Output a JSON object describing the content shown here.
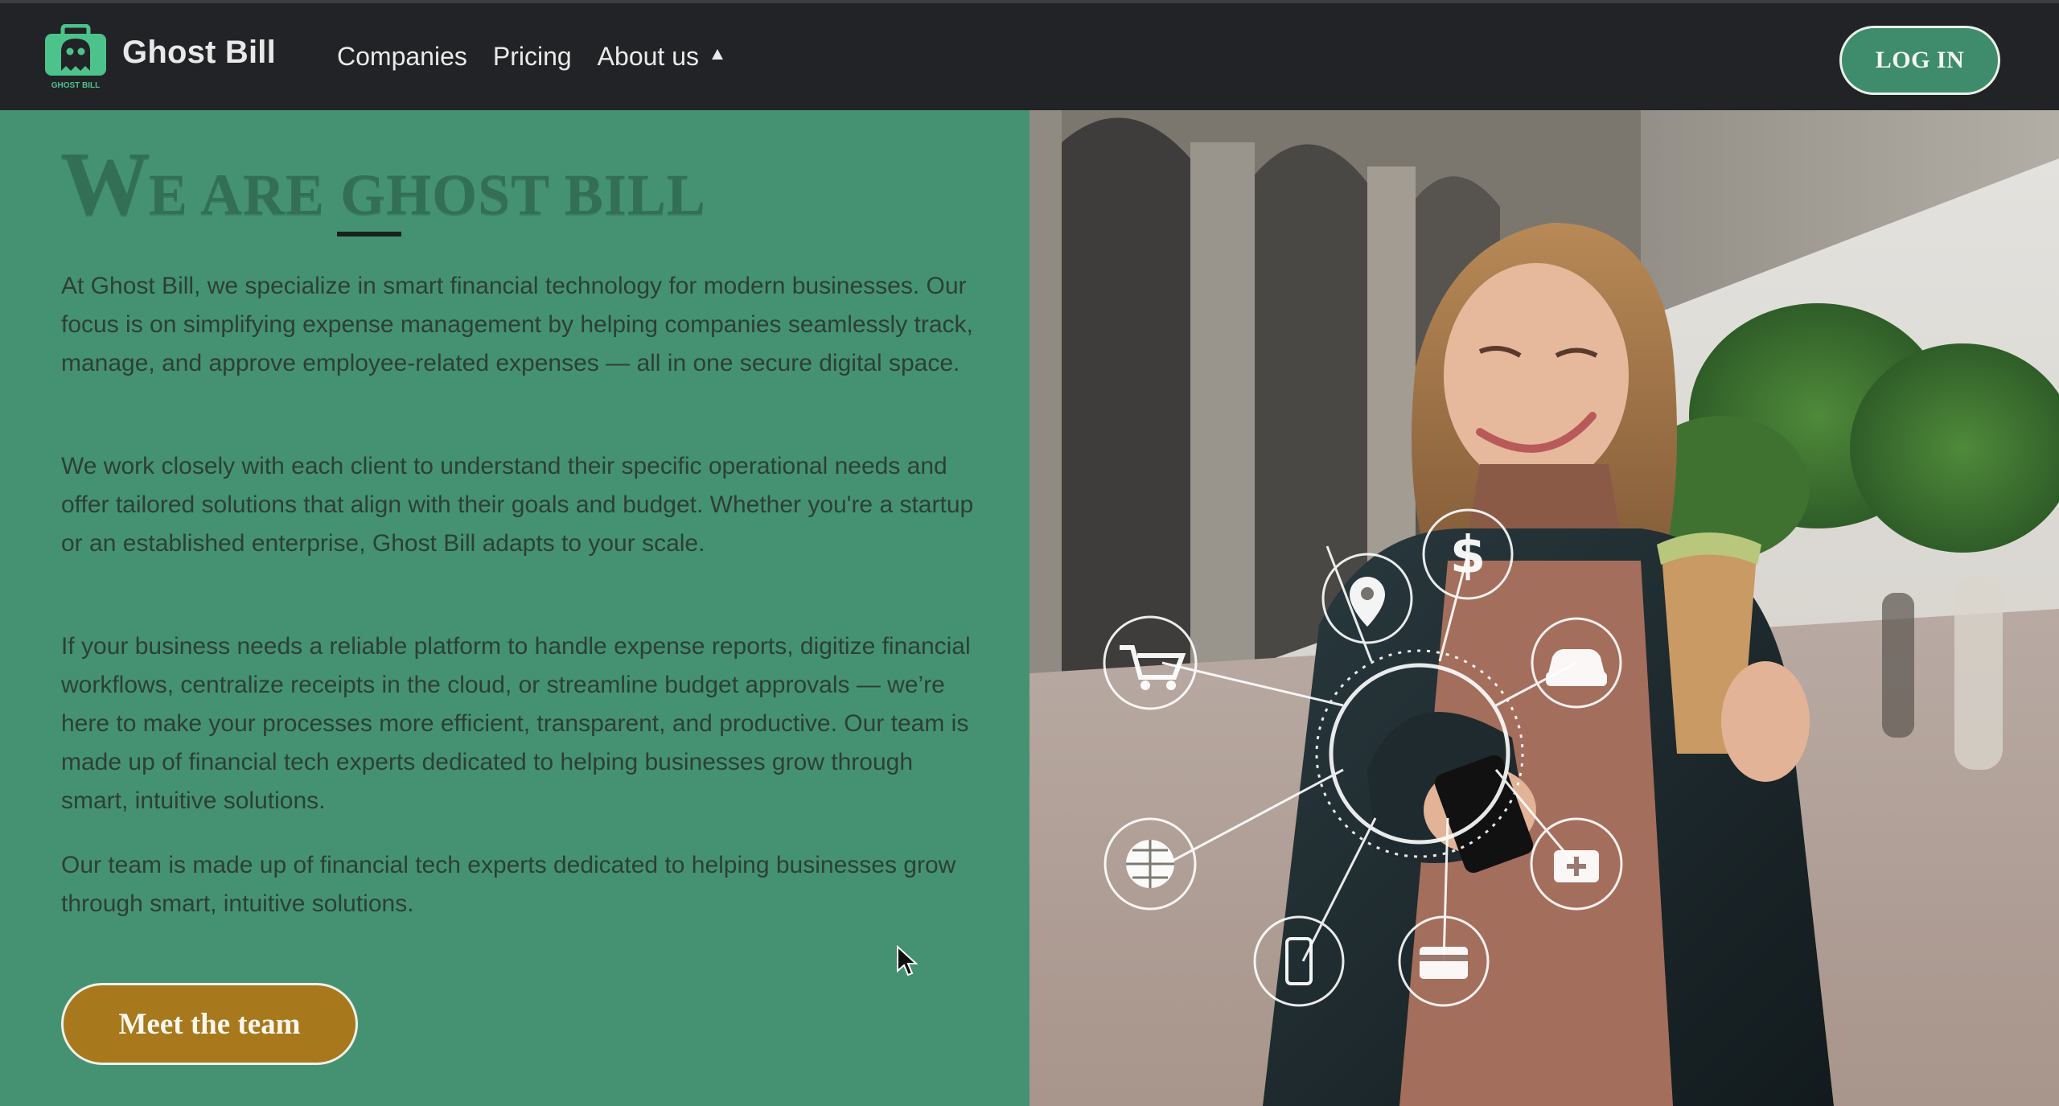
{
  "navbar": {
    "brand": {
      "logo_text": "GHOST BILL",
      "name": "Ghost Bill",
      "logo_icon": "ghost-briefcase-logo"
    },
    "links": [
      {
        "label": "Companies"
      },
      {
        "label": "Pricing"
      },
      {
        "label": "About us",
        "icon": "caret-up-icon"
      }
    ],
    "login_label": "LOG IN"
  },
  "hero": {
    "heading_first": "W",
    "heading_rest": "e are ghost bill",
    "paragraphs": [
      "At Ghost Bill, we specialize in smart financial technology for modern businesses. Our focus is on simplifying expense management by helping companies seamlessly track, manage, and approve employee-related expenses — all in one secure digital space.",
      "We work closely with each client to understand their specific operational needs and offer tailored solutions that align with their goals and budget. Whether you're a startup or an established enterprise, Ghost Bill adapts to your scale.",
      "If your business needs a reliable platform to handle expense reports, digitize financial workflows, centralize receipts in the cloud, or streamline budget approvals — we’re here to make your processes more efficient, transparent, and productive. Our team is made up of financial tech experts dedicated to helping businesses grow through smart, intuitive solutions.",
      "Our team is made up of financial tech experts dedicated to helping businesses grow through smart, intuitive solutions."
    ],
    "cta_label": "Meet the team"
  },
  "photo": {
    "icons": [
      "location-pin-icon",
      "dollar-icon",
      "shopping-cart-icon",
      "car-icon",
      "globe-icon",
      "medical-kit-icon",
      "smartphone-icon",
      "credit-card-icon"
    ]
  },
  "colors": {
    "navbar_bg": "#222326",
    "panel_bg": "#459272",
    "login_bg": "#3e8c6c",
    "cta_bg": "#a7781c",
    "heading": "#2f6a50",
    "body_text": "#2d3f37"
  }
}
